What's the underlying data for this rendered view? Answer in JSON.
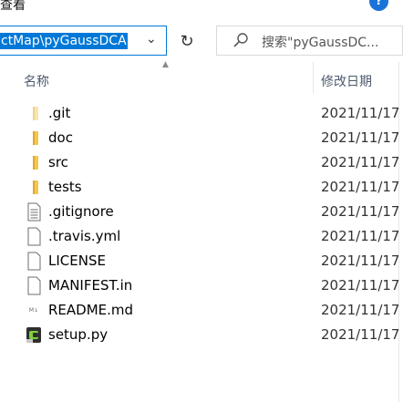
{
  "window": {
    "ribbon_tab": "查看",
    "help_label": "?"
  },
  "address": {
    "path_text": "ctMap\\pyGaussDCA"
  },
  "search": {
    "placeholder": "搜索\"pyGaussDC..."
  },
  "columns": {
    "name": "名称",
    "date_modified": "修改日期"
  },
  "files": [
    {
      "name": ".git",
      "date": "2021/11/17",
      "icon": "folder-faint-icon"
    },
    {
      "name": "doc",
      "date": "2021/11/17",
      "icon": "folder-icon"
    },
    {
      "name": "src",
      "date": "2021/11/17",
      "icon": "folder-icon"
    },
    {
      "name": "tests",
      "date": "2021/11/17",
      "icon": "folder-icon"
    },
    {
      "name": ".gitignore",
      "date": "2021/11/17",
      "icon": "text-file-icon"
    },
    {
      "name": ".travis.yml",
      "date": "2021/11/17",
      "icon": "blank-file-icon"
    },
    {
      "name": "LICENSE",
      "date": "2021/11/17",
      "icon": "blank-file-icon"
    },
    {
      "name": "MANIFEST.in",
      "date": "2021/11/17",
      "icon": "blank-file-icon"
    },
    {
      "name": "README.md",
      "date": "2021/11/17",
      "icon": "markdown-file-icon"
    },
    {
      "name": "setup.py",
      "date": "2021/11/17",
      "icon": "python-file-icon"
    }
  ],
  "colors": {
    "accent": "#0078d7",
    "folder": "#f4c74a",
    "folder_faint": "#f7e6b0",
    "header_text": "#4d5a6e"
  }
}
